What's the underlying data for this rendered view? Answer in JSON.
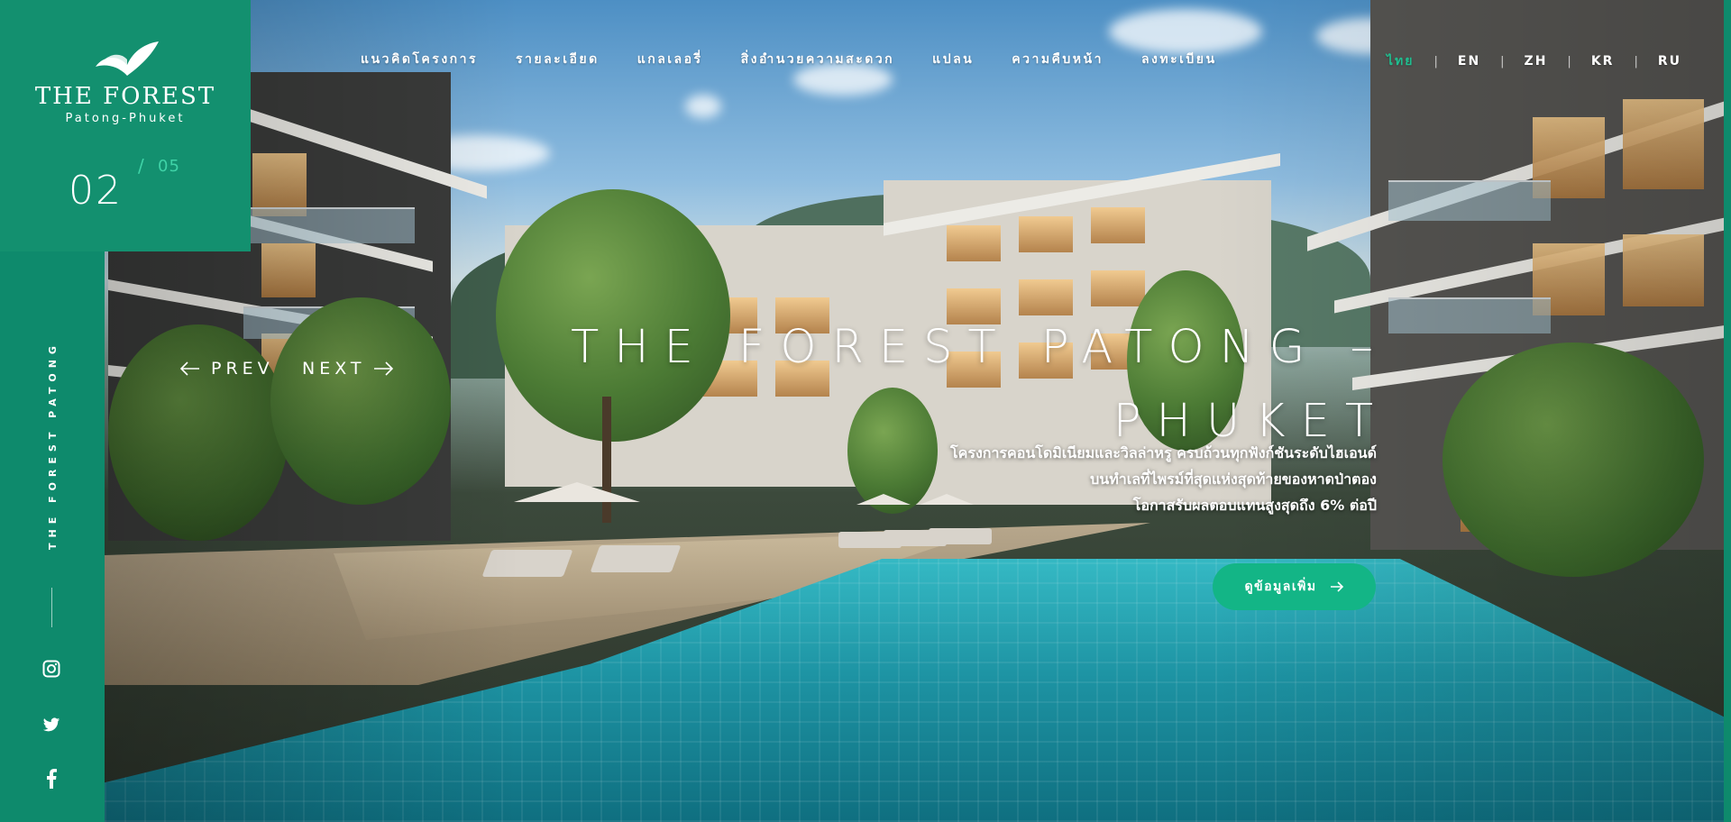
{
  "brand": {
    "name": "THE FOREST",
    "subtitle": "Patong-Phuket",
    "vertical_label": "THE FOREST PATONG"
  },
  "slider": {
    "current": "02",
    "separator": "/",
    "total": "05",
    "prev_label": "PREV",
    "next_label": "NEXT"
  },
  "nav": {
    "items": [
      {
        "label": "แนวคิดโครงการ"
      },
      {
        "label": "รายละเอียด"
      },
      {
        "label": "แกลเลอรี่"
      },
      {
        "label": "สิ่งอำนวยความสะดวก"
      },
      {
        "label": "แปลน"
      },
      {
        "label": "ความคืบหน้า"
      },
      {
        "label": "ลงทะเบียน"
      }
    ]
  },
  "languages": {
    "active": "ไทย",
    "items": [
      {
        "label": "ไทย"
      },
      {
        "label": "EN"
      },
      {
        "label": "ZH"
      },
      {
        "label": "KR"
      },
      {
        "label": "RU"
      }
    ],
    "separator": "|"
  },
  "hero": {
    "title_line1": "THE FOREST PATONG –",
    "title_line2": "PHUKET",
    "desc_line1": "โครงการคอนโดมิเนียมและวิลล่าหรู ครบถ้วนทุกฟังก์ชันระดับไฮเอนด์",
    "desc_line2": "บนทำเลที่ไพรม์ที่สุดแห่งสุดท้ายของหาดป่าตอง",
    "desc_line3": "โอกาสรับผลตอบแทนสูงสุดถึง 6% ต่อปี",
    "cta_label": "ดูข้อมูลเพิ่ม"
  },
  "social": {
    "items": [
      {
        "icon": "instagram-icon"
      },
      {
        "icon": "twitter-icon"
      },
      {
        "icon": "facebook-icon"
      }
    ]
  },
  "colors": {
    "brand_green": "#13906f",
    "sidebar_green": "#0e8a6c",
    "accent": "#1fbf90",
    "cta": "#13b586"
  }
}
